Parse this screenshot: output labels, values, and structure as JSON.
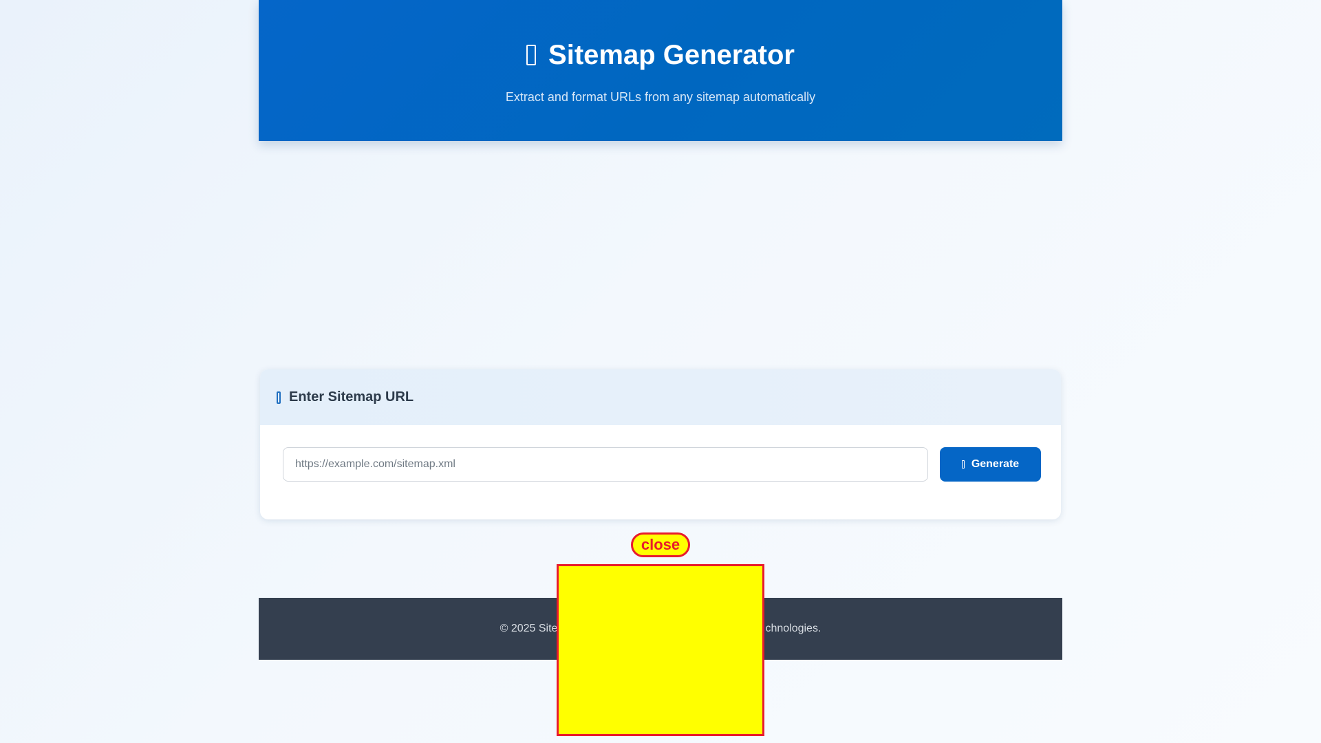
{
  "header": {
    "icon": "sitemap-icon",
    "title": "Sitemap Generator",
    "subtitle": "Extract and format URLs from any sitemap automatically"
  },
  "form": {
    "icon": "link-icon",
    "title": "Enter Sitemap URL",
    "input_placeholder": "https://example.com/sitemap.xml",
    "input_value": "",
    "button_icon": "generate-icon",
    "button_label": "Generate"
  },
  "footer": {
    "left_text": "© 2025 Site",
    "right_text": "chnologies."
  },
  "overlay": {
    "close_label": "close"
  },
  "colors": {
    "header_bg": "#0067c0",
    "primary_button": "#0566c6",
    "footer_bg": "#343f4f",
    "overlay_fill": "#ffff00",
    "overlay_border": "#e81c2c"
  }
}
